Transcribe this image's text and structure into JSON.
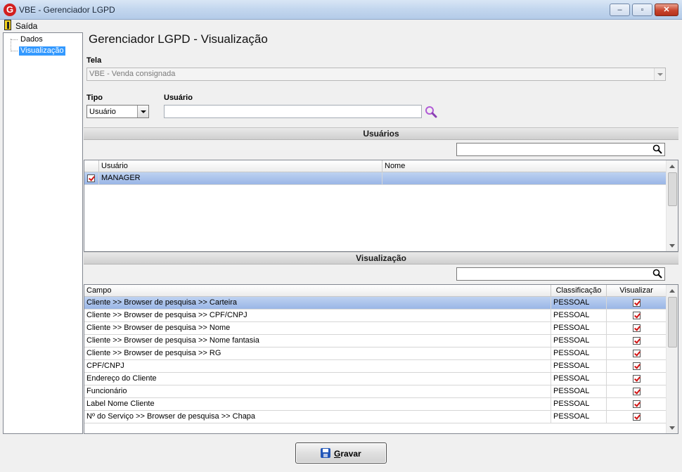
{
  "window": {
    "title": "VBE - Gerenciador LGPD",
    "app_icon": "G"
  },
  "window_controls": {
    "minimize": "–",
    "maximize": "▫",
    "close": "✕"
  },
  "menu": {
    "exit_label": "Saída"
  },
  "tree": {
    "items": [
      {
        "label": "Dados"
      },
      {
        "label": "Visualização",
        "selected": true
      }
    ]
  },
  "page": {
    "heading": "Gerenciador LGPD - Visualização"
  },
  "tela": {
    "label": "Tela",
    "value": "VBE - Venda consignada"
  },
  "tipo": {
    "label": "Tipo",
    "value": "Usuário"
  },
  "usuario": {
    "label": "Usuário",
    "value": ""
  },
  "usuarios_section": {
    "title": "Usuários",
    "filter_value": "",
    "columns": [
      "Usuário",
      "Nome"
    ],
    "rows": [
      {
        "checked": true,
        "usuario": "MANAGER",
        "nome": ""
      }
    ]
  },
  "visualizacao_section": {
    "title": "Visualização",
    "filter_value": "",
    "columns": [
      "Campo",
      "Classificação",
      "Visualizar"
    ],
    "rows": [
      {
        "campo": "Cliente >> Browser de pesquisa >> Carteira",
        "classificacao": "PESSOAL",
        "visualizar": true
      },
      {
        "campo": "Cliente >> Browser de pesquisa >> CPF/CNPJ",
        "classificacao": "PESSOAL",
        "visualizar": true
      },
      {
        "campo": "Cliente >> Browser de pesquisa >> Nome",
        "classificacao": "PESSOAL",
        "visualizar": true
      },
      {
        "campo": "Cliente >> Browser de pesquisa >> Nome fantasia",
        "classificacao": "PESSOAL",
        "visualizar": true
      },
      {
        "campo": "Cliente >> Browser de pesquisa >> RG",
        "classificacao": "PESSOAL",
        "visualizar": true
      },
      {
        "campo": "CPF/CNPJ",
        "classificacao": "PESSOAL",
        "visualizar": true
      },
      {
        "campo": "Endereço do Cliente",
        "classificacao": "PESSOAL",
        "visualizar": true
      },
      {
        "campo": "Funcionário",
        "classificacao": "PESSOAL",
        "visualizar": true
      },
      {
        "campo": "Label Nome Cliente",
        "classificacao": "PESSOAL",
        "visualizar": true
      },
      {
        "campo": "Nº do Serviço >> Browser de pesquisa >> Chapa",
        "classificacao": "PESSOAL",
        "visualizar": true
      }
    ]
  },
  "save_button": {
    "label_first": "G",
    "label_rest": "ravar"
  },
  "colors": {
    "selection": "#3399ff",
    "row_selected": "#9ab6e6",
    "check_mark": "#d21313",
    "accent_search": "#b15ad6"
  }
}
